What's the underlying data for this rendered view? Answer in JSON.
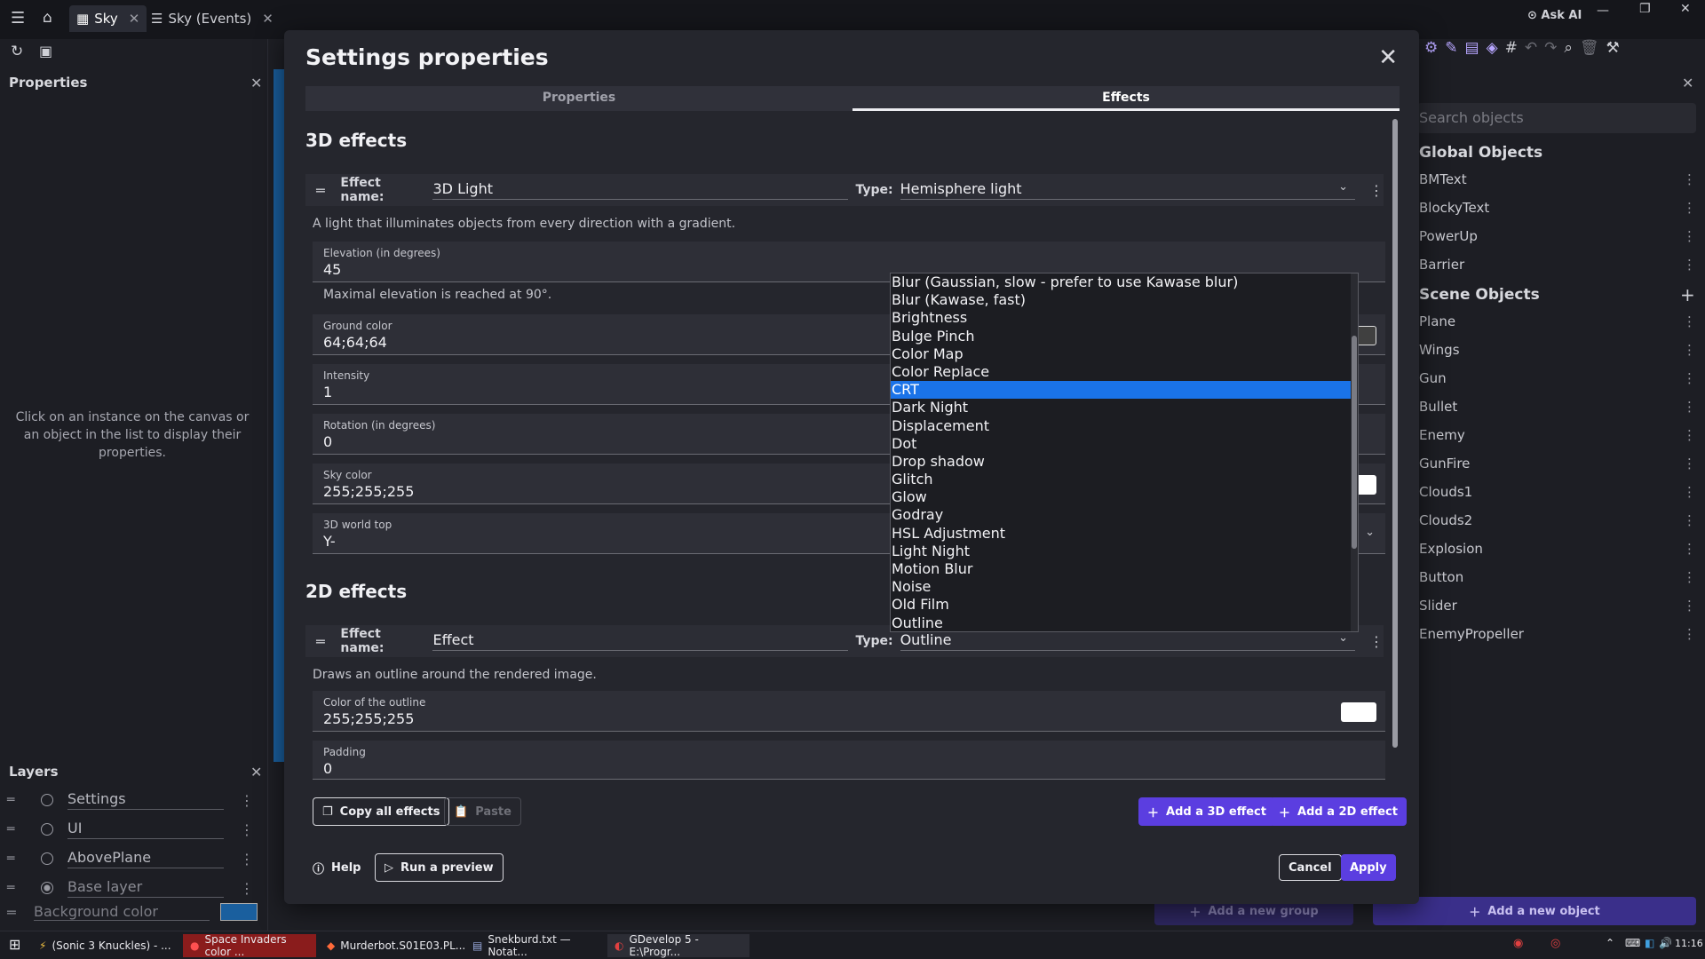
{
  "topbar": {
    "tabs": [
      {
        "label": "Sky"
      },
      {
        "label": "Sky (Events)"
      }
    ],
    "ask_ai": "Ask AI"
  },
  "left": {
    "properties_title": "Properties",
    "hint": "Click on an instance on the canvas or an object in the list to display their properties.",
    "layers_title": "Layers",
    "layers": [
      "Settings",
      "UI",
      "AbovePlane",
      "Base layer"
    ],
    "background_color_label": "Background color",
    "background_color": "#1a5f9e"
  },
  "right": {
    "search_placeholder": "Search objects",
    "global_objects_title": "Global Objects",
    "global_objects": [
      "BMText",
      "BlockyText",
      "PowerUp",
      "Barrier"
    ],
    "scene_objects_title": "Scene Objects",
    "scene_objects": [
      "Plane",
      "Wings",
      "Gun",
      "Bullet",
      "Enemy",
      "GunFire",
      "Clouds1",
      "Clouds2",
      "Explosion",
      "Button",
      "Slider",
      "EnemyPropeller"
    ],
    "add_group": "Add a new group",
    "add_object": "Add a new object"
  },
  "modal": {
    "title": "Settings properties",
    "tabs": [
      "Properties",
      "Effects"
    ],
    "section_3d": "3D effects",
    "section_2d": "2D effects",
    "effect_name_label": "Effect name:",
    "type_label": "Type:",
    "effect3d": {
      "name": "3D Light",
      "type": "Hemisphere light",
      "description": "A light that illuminates objects from every direction with a gradient.",
      "fields": [
        {
          "label": "Elevation (in degrees)",
          "value": "45"
        },
        {
          "label": "Ground color",
          "value": "64;64;64"
        },
        {
          "label": "Intensity",
          "value": "1"
        },
        {
          "label": "Rotation (in degrees)",
          "value": "0"
        },
        {
          "label": "Sky color",
          "value": "255;255;255"
        },
        {
          "label": "3D world top",
          "value": "Y-"
        }
      ],
      "elevation_note": "Maximal elevation is reached at 90°."
    },
    "effect2d": {
      "name": "Effect",
      "type": "Outline",
      "description": "Draws an outline around the rendered image.",
      "fields": [
        {
          "label": "Color of the outline",
          "value": "255;255;255"
        },
        {
          "label": "Padding",
          "value": "0"
        }
      ]
    },
    "dropdown_options": [
      "Blur (Gaussian, slow - prefer to use Kawase blur)",
      "Blur (Kawase, fast)",
      "Brightness",
      "Bulge Pinch",
      "Color Map",
      "Color Replace",
      "CRT",
      "Dark Night",
      "Displacement",
      "Dot",
      "Drop shadow",
      "Glitch",
      "Glow",
      "Godray",
      "HSL Adjustment",
      "Light Night",
      "Motion Blur",
      "Noise",
      "Old Film",
      "Outline"
    ],
    "dropdown_selected": "CRT",
    "buttons": {
      "copy_all": "Copy all effects",
      "paste": "Paste",
      "add_3d": "Add a 3D effect",
      "add_2d": "Add a 2D effect",
      "help": "Help",
      "run_preview": "Run a preview",
      "cancel": "Cancel",
      "apply": "Apply"
    }
  },
  "taskbar": {
    "items": [
      "(Sonic 3 Knuckles) - ...",
      "Space Invaders color ...",
      "Murderbot.S01E03.PL...",
      "Snekburd.txt — Notat...",
      "GDevelop 5 - E:\\Progr..."
    ],
    "time": "11:16"
  }
}
